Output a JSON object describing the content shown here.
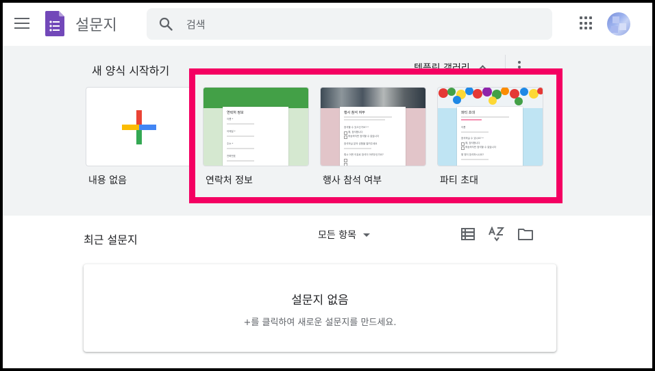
{
  "header": {
    "app_title": "설문지",
    "search": {
      "placeholder": "검색",
      "value": ""
    },
    "icons": [
      "menu-icon",
      "forms-logo-icon",
      "search-icon",
      "apps-grid-icon",
      "avatar"
    ]
  },
  "gallery": {
    "title": "새 양식 시작하기",
    "toggle_label": "템플릿 갤러리",
    "templates": [
      {
        "label": "내용 없음"
      },
      {
        "label": "연락처 정보",
        "preview_title": "연락처 정보",
        "preview_fields": [
          "이름 *",
          "이메일 *",
          "주소 *",
          "전화번호"
        ]
      },
      {
        "label": "행사 참석 여부",
        "preview_title": "행사 참석 여부",
        "preview_fields": [
          "참석할 수 있으신가요? *",
          "예, 참석합니다",
          "죄송하지만 참석할 수 없습니다",
          "참석하실 분의 성함을 알려주세요",
          "혹시 어떤 이유로 참석이 어려우신가요?"
        ]
      },
      {
        "label": "파티 초대",
        "preview_title": "파티 초대",
        "preview_fields": [
          "이름",
          "참석하실 수 있나요? *",
          "예, 참석합니다",
          "죄송하지만 참석할 수 없습니다",
          "몇 명이 참석하시나요?"
        ]
      }
    ],
    "highlight_color": "#f40062"
  },
  "recent": {
    "title": "최근 설문지",
    "filter_label": "모든 항목",
    "empty_title": "설문지 없음",
    "empty_subtitle": "+를 클릭하여 새로운 설문지를 만드세요."
  },
  "colors": {
    "brand_purple": "#7248b9",
    "gallery_bg": "#f1f3f4",
    "contact_green": "#43a047",
    "event_pink": "#e2c5c9",
    "party_blue": "#bfe4f3"
  }
}
